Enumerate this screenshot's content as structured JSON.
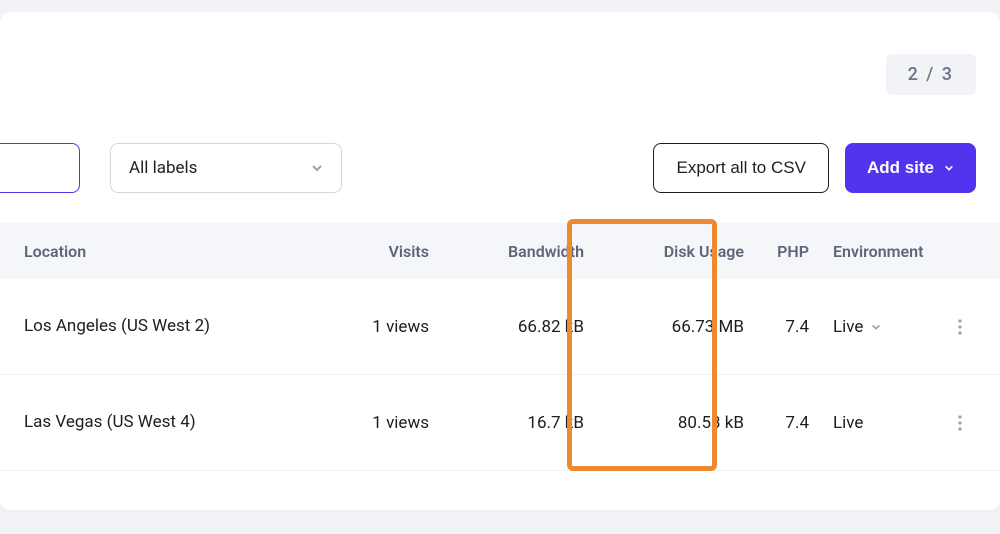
{
  "pagination": {
    "text": "2 / 3"
  },
  "toolbar": {
    "labels_dropdown": "All labels",
    "export_btn": "Export all to CSV",
    "add_btn": "Add site"
  },
  "table": {
    "headers": {
      "location": "Location",
      "visits": "Visits",
      "bandwidth": "Bandwidth",
      "disk_usage": "Disk Usage",
      "php": "PHP",
      "environment": "Environment"
    },
    "rows": [
      {
        "location": "Los Angeles (US West 2)",
        "visits": "1 views",
        "bandwidth": "66.82 kB",
        "disk_usage": "66.73 MB",
        "php": "7.4",
        "environment": "Live",
        "env_expandable": true
      },
      {
        "location": "Las Vegas (US West 4)",
        "visits": "1 views",
        "bandwidth": "16.7 kB",
        "disk_usage": "80.53 kB",
        "php": "7.4",
        "environment": "Live",
        "env_expandable": false
      }
    ]
  },
  "highlight": {
    "column": "disk_usage"
  }
}
